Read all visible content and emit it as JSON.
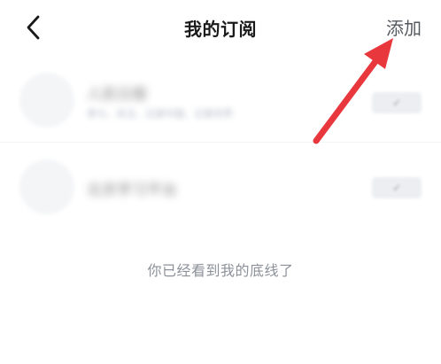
{
  "header": {
    "title": "我的订阅",
    "add_label": "添加",
    "back_icon": "chevron-left-icon"
  },
  "subscriptions": [
    {
      "name": "人民日报",
      "subtitle": "参与、关注、记录中国、记录世界",
      "action": "✓"
    },
    {
      "name": "北京学习平台",
      "action": "✓"
    }
  ],
  "footer": {
    "end_text": "你已经看到我的底线了"
  },
  "annotation": {
    "arrow_color": "#e8383d",
    "arrow_icon": "pointer-arrow-icon"
  }
}
